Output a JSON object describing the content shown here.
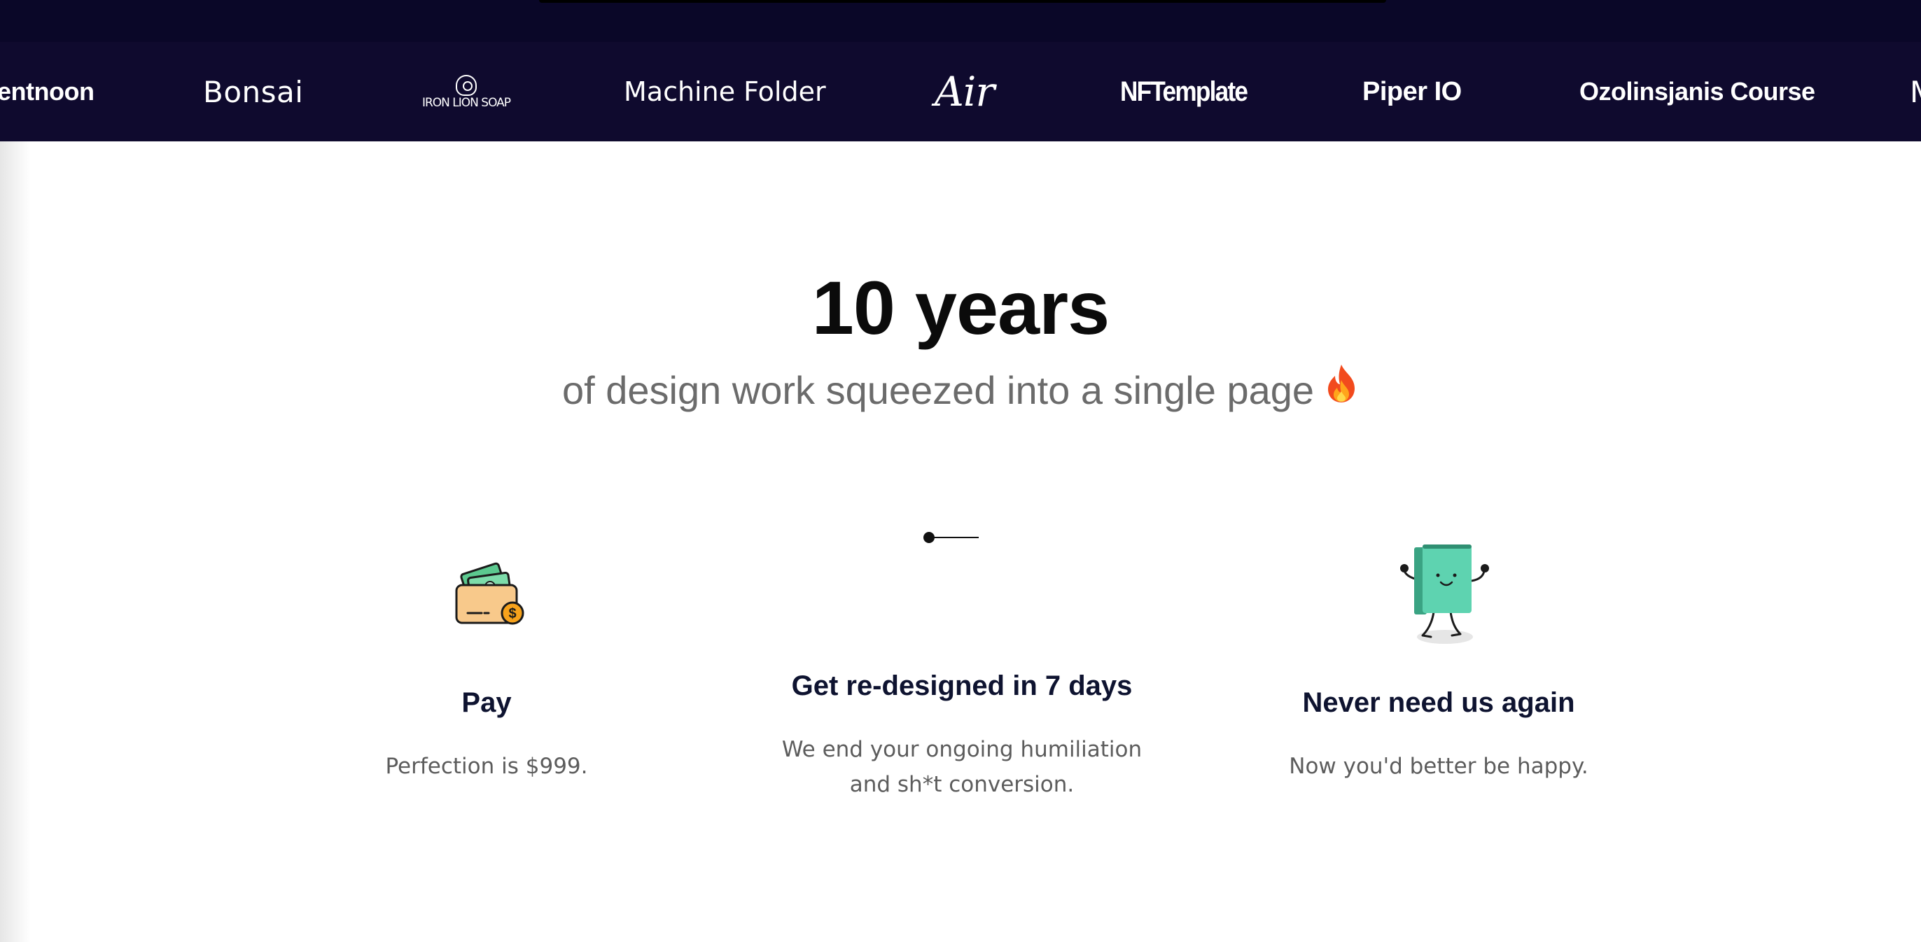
{
  "logos": {
    "items": [
      {
        "label": "entnoon"
      },
      {
        "label": "Bonsai"
      },
      {
        "label": "IRON LION SOAP"
      },
      {
        "label": "Machine Folder"
      },
      {
        "label": "Air"
      },
      {
        "label": "NFTemplate"
      },
      {
        "label": "Piper IO"
      },
      {
        "label": "Ozolinsjanis Course"
      },
      {
        "label": "M"
      }
    ]
  },
  "hero": {
    "title": "10 years",
    "subtitle": "of design work squeezed into a single page",
    "subtitle_icon": "fire-icon"
  },
  "steps": [
    {
      "icon": "wallet-money-icon",
      "title": "Pay",
      "description": "Perfection is $999."
    },
    {
      "icon": "timeline-dot-icon",
      "title": "Get re-designed in 7 days",
      "description_line1": "We end your ongoing humiliation",
      "description_line2": "and sh*t conversion."
    },
    {
      "icon": "happy-book-icon",
      "title": "Never need us again",
      "description": "Now you'd better be happy."
    }
  ],
  "colors": {
    "header_bg": "#0f0a2e",
    "top_strip_bg": "#0a0728",
    "title_text": "#0b0b0b",
    "subtitle_text": "#6b6b6b",
    "step_title_text": "#0e1330",
    "book_green": "#5ed3b0"
  }
}
